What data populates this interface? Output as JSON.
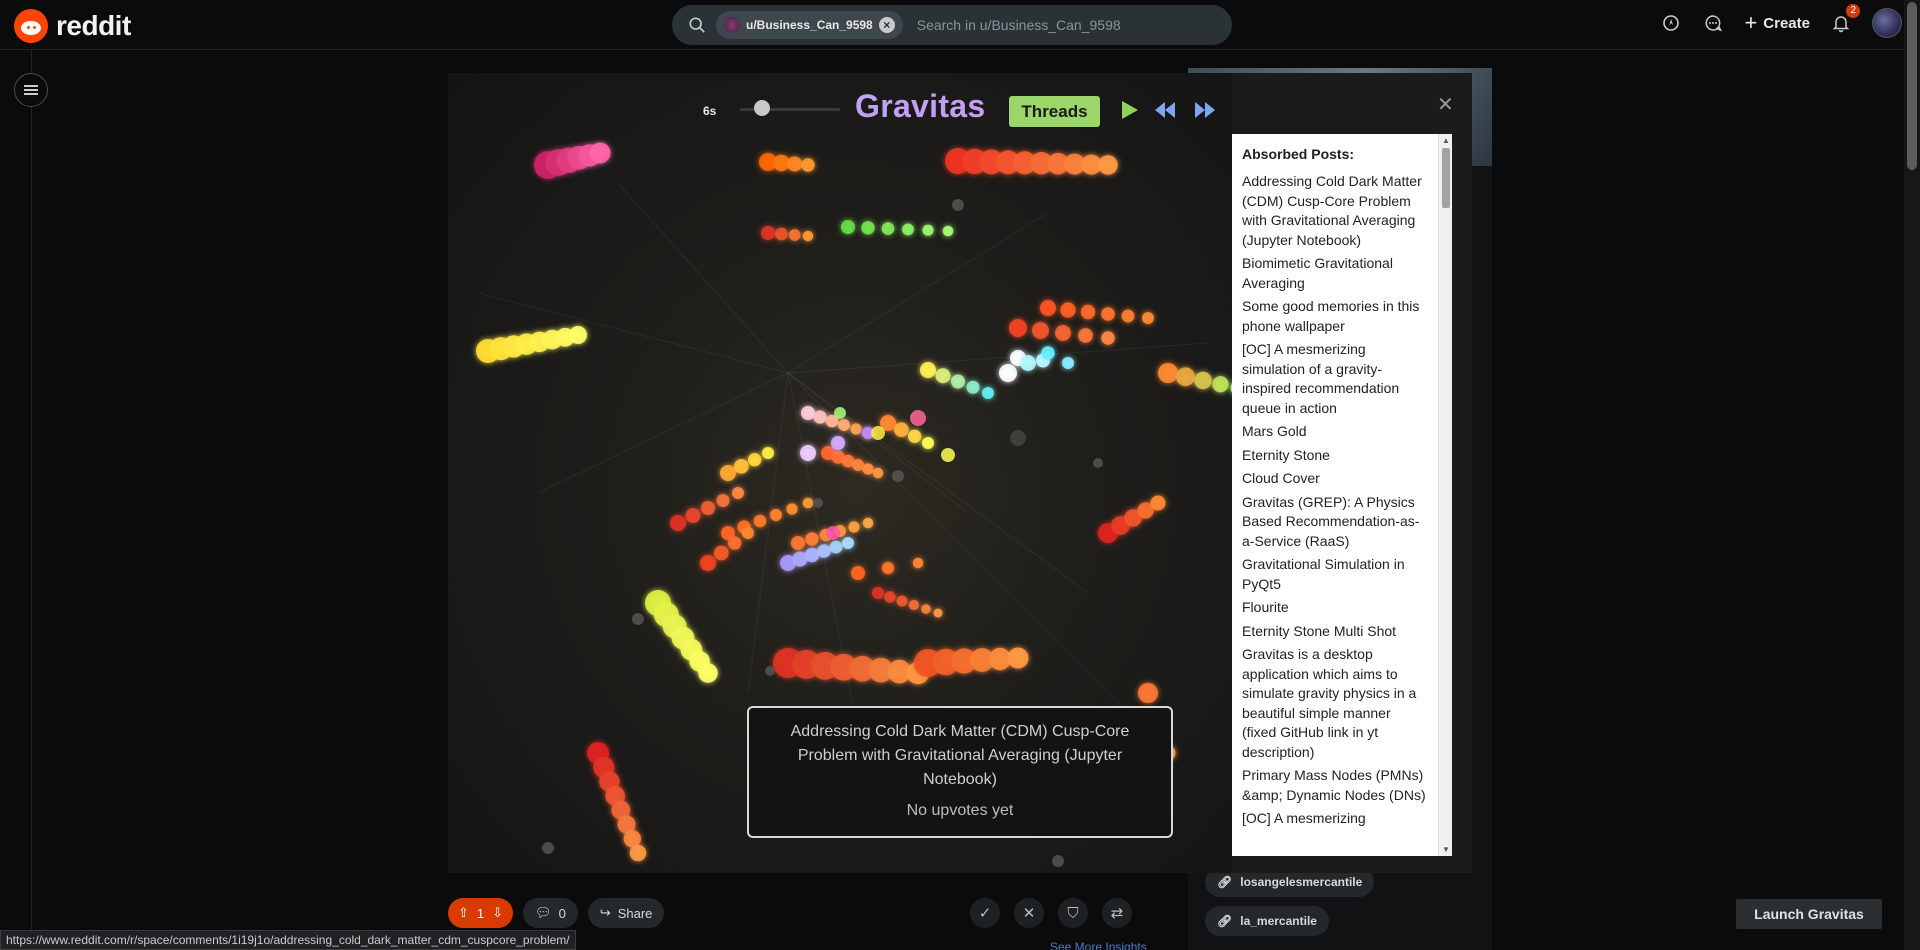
{
  "header": {
    "logo_text": "reddit",
    "search_chip": "u/Business_Can_9598",
    "search_placeholder": "Search in u/Business_Can_9598",
    "create_label": "Create",
    "notifications_count": "2"
  },
  "modal": {
    "title": "Gravitas",
    "threads_button": "Threads",
    "time_label": "6s",
    "slider_value_fraction": 0.22,
    "absorbed_title": "Absorbed Posts:",
    "absorbed_posts": [
      "Addressing Cold Dark Matter (CDM) Cusp-Core Problem with Gravitational Averaging (Jupyter Notebook)",
      "Biomimetic Gravitational Averaging",
      "Some good memories in this phone wallpaper",
      "[OC] A mesmerizing simulation of a gravity-inspired recommendation queue in action",
      "Mars Gold",
      "Eternity Stone",
      "Cloud Cover",
      "Gravitas (GREP): A Physics Based Recommendation-as-a-Service (RaaS)",
      "Gravitational Simulation in PyQt5",
      "Flourite",
      "Eternity Stone Multi Shot",
      "Gravitas is a desktop application which aims to simulate gravity physics in a beautiful simple manner (fixed GitHub link in yt description)",
      "Primary Mass Nodes (PMNs) &amp; Dynamic Nodes (DNs)",
      "[OC] A mesmerizing"
    ],
    "tooltip": {
      "title": "Addressing Cold Dark Matter (CDM) Cusp-Core Problem with Gravitational Averaging (Jupyter Notebook)",
      "subtitle": "No upvotes yet"
    }
  },
  "post_actions": {
    "vote_count": "1",
    "comment_count": "0",
    "share_label": "Share",
    "see_more": "See More Insights"
  },
  "sidebar_tags": [
    "losangelesmercantile",
    "la_mercantile"
  ],
  "launch_button": "Launch Gravitas",
  "status_url": "https://www.reddit.com/r/space/comments/1i19j1o/addressing_cold_dark_matter_cdm_cuspcore_problem/",
  "colors": {
    "title_purple": "#c2a1f5",
    "threads_green": "#9bd66a",
    "upvote_orange": "#d93a00",
    "control_green": "#8fd45a",
    "control_blue": "#7ea6f0"
  }
}
